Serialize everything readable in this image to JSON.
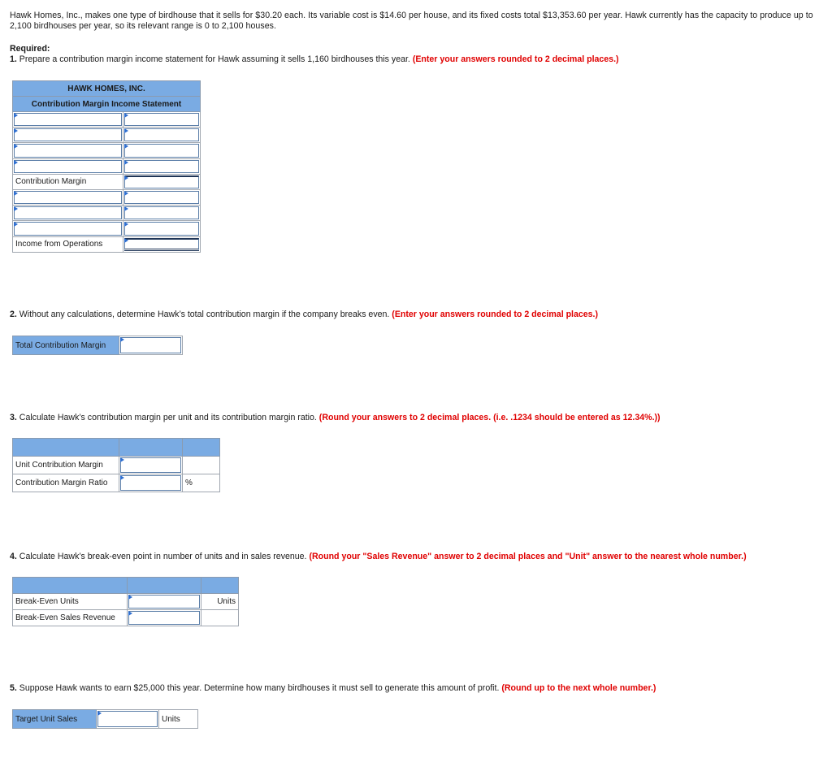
{
  "intro": "Hawk Homes, Inc., makes one type of birdhouse that it sells for $30.20 each. Its variable cost is $14.60 per house, and its fixed costs total $13,353.60 per year. Hawk currently has the capacity to produce up to 2,100 birdhouses per year, so its relevant range is 0 to 2,100 houses.",
  "required_label": "Required:",
  "q1": {
    "num": "1.",
    "text": " Prepare a contribution margin income statement for Hawk assuming it sells 1,160 birdhouses this year. ",
    "hint": "(Enter your answers rounded to 2 decimal places.)"
  },
  "statement": {
    "company": "HAWK HOMES, INC.",
    "title": "Contribution Margin Income Statement",
    "rows": [
      {
        "label": "",
        "label_input": true,
        "value": ""
      },
      {
        "label": "",
        "label_input": true,
        "value": ""
      },
      {
        "label": "",
        "label_input": true,
        "value": ""
      },
      {
        "label": "",
        "label_input": true,
        "value": ""
      },
      {
        "label": "Contribution Margin",
        "label_input": false,
        "value": ""
      },
      {
        "label": "",
        "label_input": true,
        "value": ""
      },
      {
        "label": "",
        "label_input": true,
        "value": ""
      },
      {
        "label": "",
        "label_input": true,
        "value": ""
      },
      {
        "label": "Income from Operations",
        "label_input": false,
        "value": ""
      }
    ]
  },
  "q2": {
    "num": "2.",
    "text": " Without any calculations, determine Hawk’s total contribution margin if the company breaks even. ",
    "hint": "(Enter your answers rounded to 2 decimal places.)",
    "label": "Total Contribution Margin",
    "value": ""
  },
  "q3": {
    "num": "3.",
    "text": " Calculate Hawk’s contribution margin per unit and its contribution margin ratio. ",
    "hint": "(Round your answers to 2 decimal places. (i.e. .1234 should be entered as 12.34%.))",
    "rows": [
      {
        "label": "Unit Contribution Margin",
        "value": "",
        "unit": ""
      },
      {
        "label": "Contribution Margin Ratio",
        "value": "",
        "unit": "%"
      }
    ]
  },
  "q4": {
    "num": "4.",
    "text": " Calculate Hawk’s break-even point in number of units and in sales revenue. ",
    "hint": "(Round your \"Sales Revenue\" answer to 2 decimal places and \"Unit\" answer to the nearest whole number.)",
    "rows": [
      {
        "label": "Break-Even Units",
        "value": "",
        "unit": "Units"
      },
      {
        "label": "Break-Even Sales Revenue",
        "value": "",
        "unit": ""
      }
    ]
  },
  "q5": {
    "num": "5.",
    "text": " Suppose Hawk wants to earn $25,000 this year. Determine how many birdhouses it must sell to generate this amount of profit. ",
    "hint": "(Round up to the next whole number.)",
    "label": "Target Unit Sales",
    "value": "",
    "unit": "Units"
  }
}
